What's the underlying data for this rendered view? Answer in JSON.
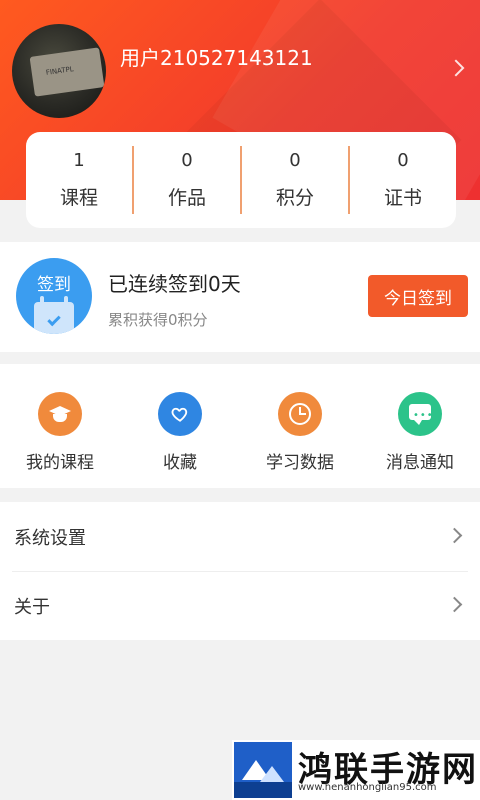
{
  "profile": {
    "username": "用户210527143121",
    "avatar_text": "FINATPL"
  },
  "stats": [
    {
      "value": "1",
      "label": "课程"
    },
    {
      "value": "0",
      "label": "作品"
    },
    {
      "value": "0",
      "label": "积分"
    },
    {
      "value": "0",
      "label": "证书"
    }
  ],
  "checkin": {
    "icon_tag": "签到",
    "title": "已连续签到0天",
    "subtitle": "累积获得0积分",
    "button": "今日签到"
  },
  "quick_actions": [
    {
      "label": "我的课程",
      "icon": "graduation-cap-icon",
      "color": "#f08a3c"
    },
    {
      "label": "收藏",
      "icon": "heart-icon",
      "color": "#2f86e2"
    },
    {
      "label": "学习数据",
      "icon": "clock-icon",
      "color": "#f08a3c"
    },
    {
      "label": "消息通知",
      "icon": "message-icon",
      "color": "#2cc38a"
    }
  ],
  "menu": [
    {
      "label": "系统设置"
    },
    {
      "label": "关于"
    }
  ],
  "watermark": {
    "title": "鸿联手游网",
    "url": "www.henanhonglian95.com"
  },
  "colors": {
    "accent": "#f25a2a",
    "header_start": "#ff5a1f",
    "header_end": "#ee3030",
    "checkin_blue": "#3b9df0"
  }
}
